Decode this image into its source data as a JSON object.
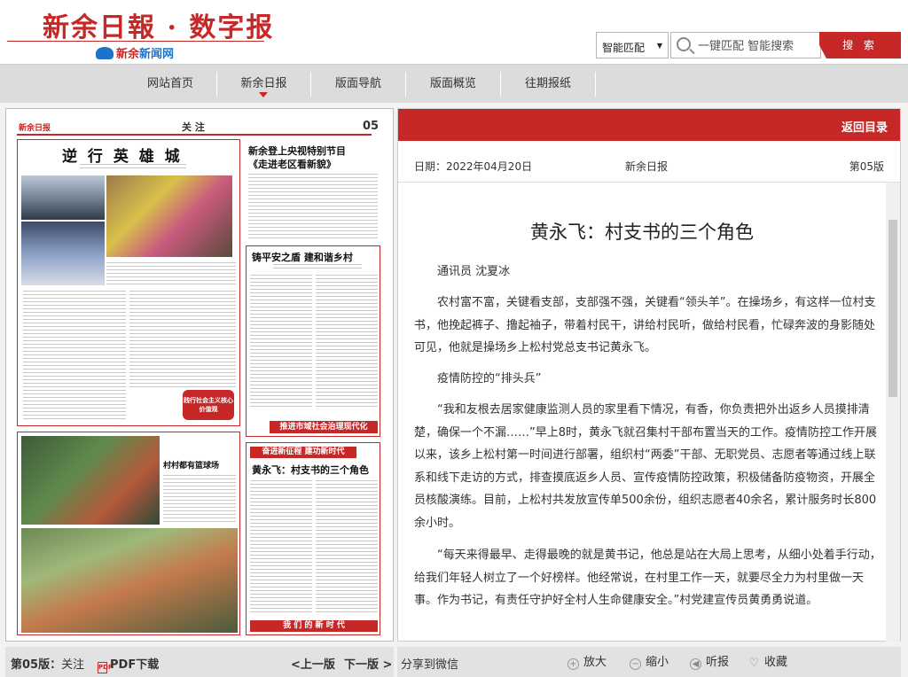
{
  "header": {
    "logo_title": "新余日報 · 数字报",
    "logo_sub_brand": "新余",
    "logo_sub_net": "新闻网",
    "search_mode": "智能匹配",
    "search_placeholder": "一键匹配 智能搜索",
    "search_button": "搜 索"
  },
  "nav": {
    "items": [
      {
        "label": "网站首页"
      },
      {
        "label": "新余日报"
      },
      {
        "label": "版面导航"
      },
      {
        "label": "版面概览"
      },
      {
        "label": "往期报纸"
      }
    ],
    "active_index": 1
  },
  "newspaper": {
    "masthead": "新余日报",
    "section": "关 注",
    "page_no": "05",
    "headline_1": "逆 行 英 雄 城",
    "headline_2a": "新余登上央视特别节目",
    "headline_2b": "《走进老区看新貌》",
    "headline_3": "铸平安之盾 建和谐乡村",
    "headline_4": "村村都有篮球场",
    "banner_1": "推进市域社会治理现代化",
    "banner_2": "奋进新征程 建功新时代",
    "headline_5": "黄永飞：村支书的三个角色",
    "banner_3": "我 们 的 新 时 代",
    "badge": "践行社会主义核心价值观"
  },
  "left_footer": {
    "issue_label": "第05版：",
    "issue_section": "关注",
    "pdf_label": "PDF下载",
    "prev_label": "<上一版",
    "next_label": "下一版 >"
  },
  "article_panel": {
    "back_label": "返回目录",
    "date": "日期：2022年04月20日",
    "paper": "新余日报",
    "edition": "第05版",
    "title": "黄永飞：村支书的三个角色",
    "paragraphs": [
      "通讯员 沈夏冰",
      "农村富不富，关键看支部，支部强不强，关键看“领头羊”。在操场乡，有这样一位村支书，他挽起裤子、撸起袖子，带着村民干，讲给村民听，做给村民看，忙碌奔波的身影随处可见，他就是操场乡上松村党总支书记黄永飞。",
      "疫情防控的“排头兵”",
      "“我和友根去居家健康监测人员的家里看下情况，有香，你负责把外出返乡人员摸排清楚，确保一个不漏……”早上8时，黄永飞就召集村干部布置当天的工作。疫情防控工作开展以来，该乡上松村第一时间进行部署，组织村“两委”干部、无职党员、志愿者等通过线上联系和线下走访的方式，排查摸底返乡人员、宣传疫情防控政策，积极储备防疫物资，开展全员核酸演练。目前，上松村共发放宣传单500余份，组织志愿者40余名，累计服务时长800余小时。",
      "“每天来得最早、走得最晚的就是黄书记，他总是站在大局上思考，从细小处着手行动，给我们年轻人树立了一个好榜样。他经常说，在村里工作一天，就要尽全力为村里做一天事。作为书记，有责任守护好全村人生命健康安全。”村党建宣传员黄勇勇说道。"
    ]
  },
  "right_footer": {
    "share": "分享到微信",
    "zoom_in": "放大",
    "zoom_out": "缩小",
    "listen": "听报",
    "favorite": "收藏"
  },
  "colors": {
    "brand_red": "#c62828",
    "nav_bg": "#dcdcdc",
    "link_blue": "#1e73c6"
  },
  "icons": [
    "search-icon",
    "caret-down-icon",
    "pdf-icon",
    "zoom-in-icon",
    "zoom-out-icon",
    "listen-icon",
    "heart-icon",
    "nav-active-arrow-icon"
  ]
}
